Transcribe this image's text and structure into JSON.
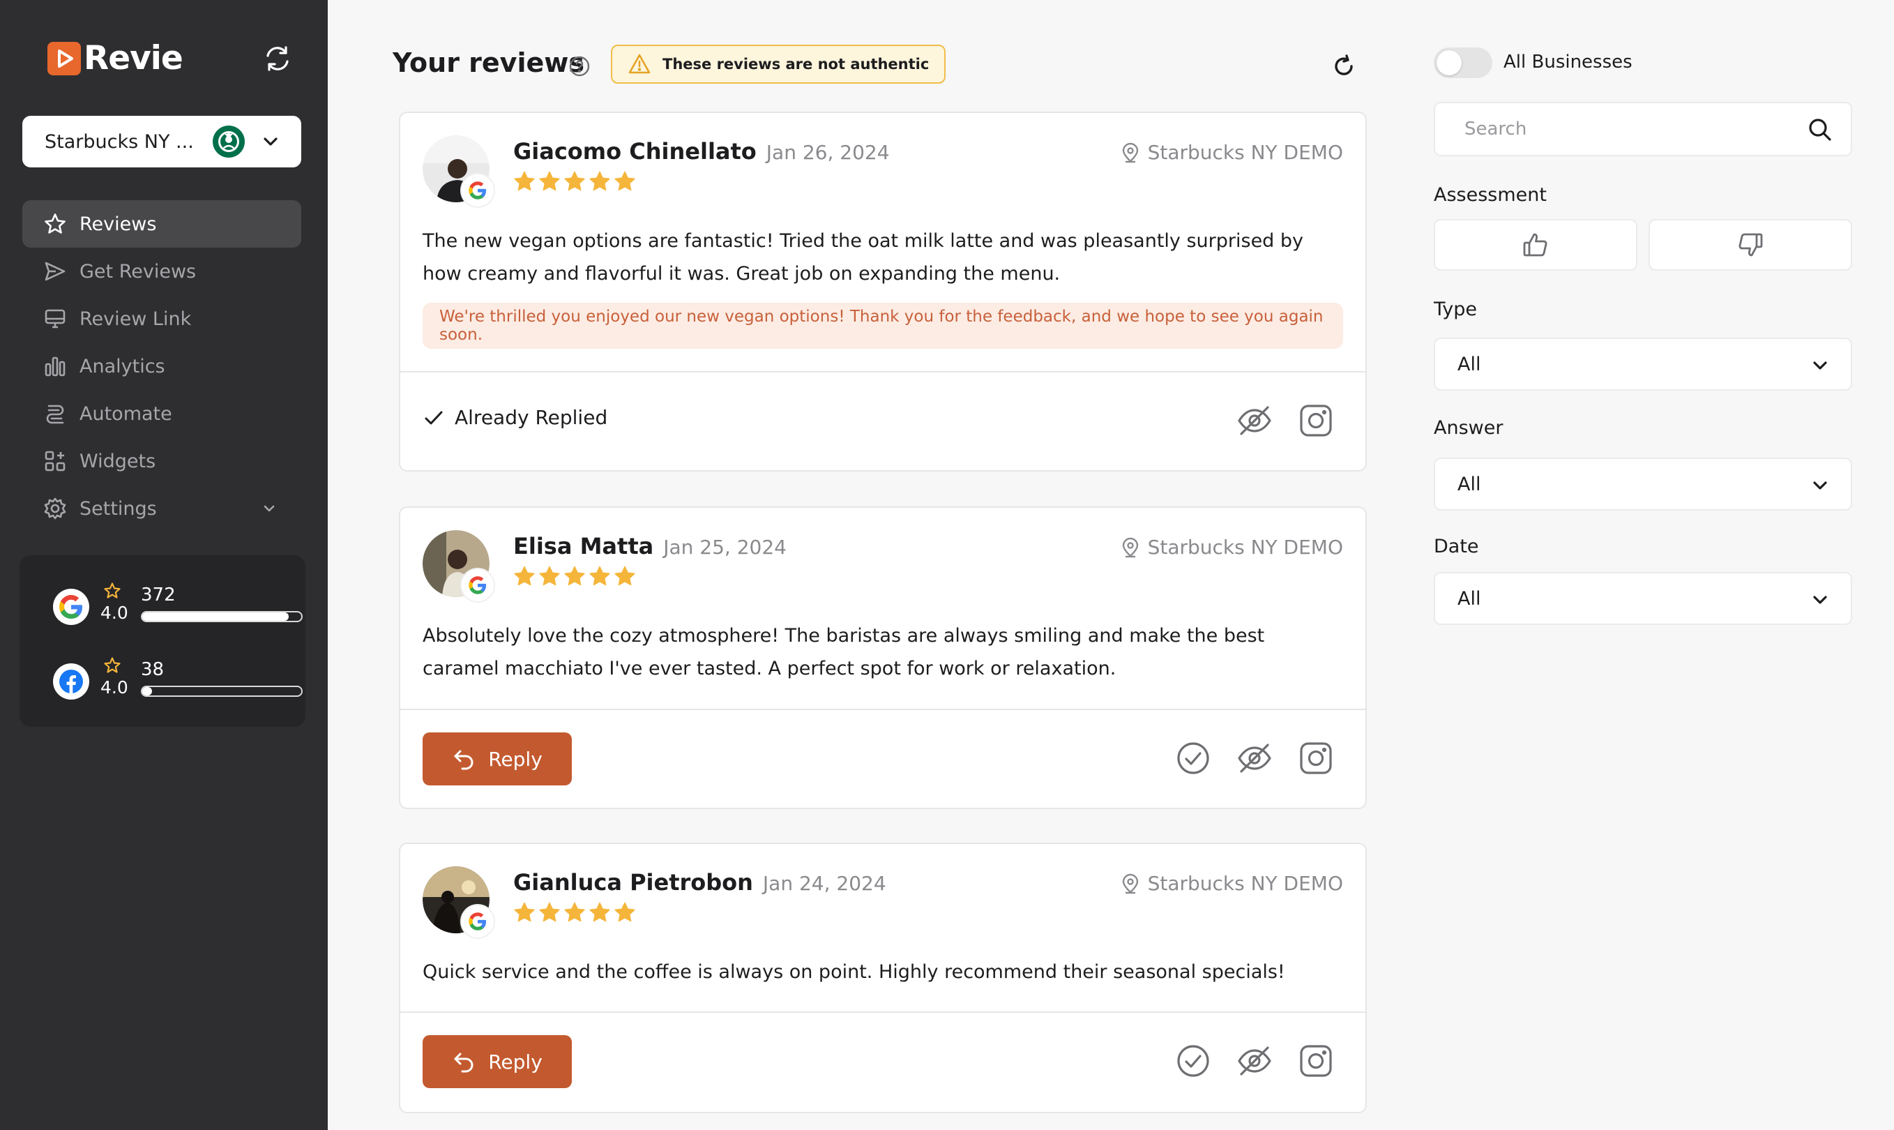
{
  "app": {
    "name": "Revie"
  },
  "business_selector": {
    "value": "Starbucks NY ..."
  },
  "nav": {
    "items": [
      {
        "label": "Reviews"
      },
      {
        "label": "Get Reviews"
      },
      {
        "label": "Review Link"
      },
      {
        "label": "Analytics"
      },
      {
        "label": "Automate"
      },
      {
        "label": "Widgets"
      },
      {
        "label": "Settings"
      }
    ]
  },
  "stats": {
    "google": {
      "rating": "4.0",
      "count": "372",
      "progress": 0.92
    },
    "facebook": {
      "rating": "4.0",
      "count": "38",
      "progress": 0.06
    }
  },
  "header": {
    "title": "Your reviews",
    "alert": "These reviews are not authentic"
  },
  "reviews": [
    {
      "author": "Giacomo Chinellato",
      "date": "Jan 26, 2024",
      "location": "Starbucks NY DEMO",
      "rating": 5,
      "text": "The new vegan options are fantastic! Tried the oat milk latte and was pleasantly surprised by how creamy and flavorful it was. Great job on expanding the menu.",
      "reply": "We're thrilled you enjoyed our new vegan options! Thank you for the feedback, and we hope to see you again soon.",
      "status": "Already Replied"
    },
    {
      "author": "Elisa Matta",
      "date": "Jan 25, 2024",
      "location": "Starbucks NY DEMO",
      "rating": 5,
      "text": "Absolutely love the cozy atmosphere! The baristas are always smiling and make the best caramel macchiato I've ever tasted. A perfect spot for work or relaxation.",
      "reply_button": "Reply"
    },
    {
      "author": "Gianluca Pietrobon",
      "date": "Jan 24, 2024",
      "location": "Starbucks NY DEMO",
      "rating": 5,
      "text": "Quick service and the coffee is always on point. Highly recommend their seasonal specials!",
      "reply_button": "Reply"
    }
  ],
  "filters": {
    "all_businesses_label": "All Businesses",
    "search_placeholder": "Search",
    "assessment_label": "Assessment",
    "type": {
      "label": "Type",
      "value": "All"
    },
    "answer": {
      "label": "Answer",
      "value": "All"
    },
    "date": {
      "label": "Date",
      "value": "All"
    }
  },
  "colors": {
    "sidebar": "#2e2e30",
    "accent": "#c35a2f",
    "star": "#f5b53b",
    "alert_border": "#f2bd4a"
  }
}
